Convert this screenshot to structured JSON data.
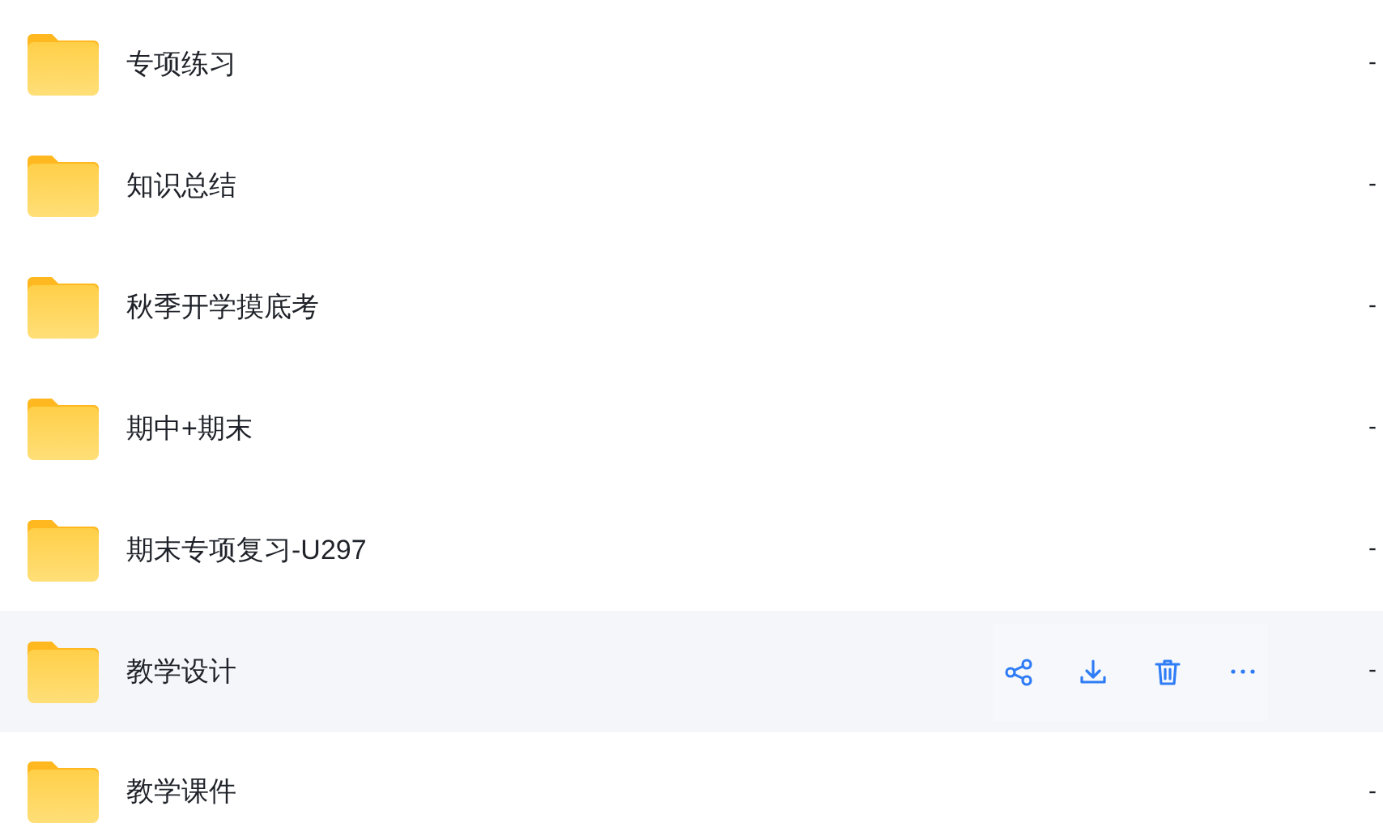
{
  "rows": [
    {
      "name": "专项练习",
      "size": "-",
      "hovered": false
    },
    {
      "name": "知识总结",
      "size": "-",
      "hovered": false
    },
    {
      "name": "秋季开学摸底考",
      "size": "-",
      "hovered": false
    },
    {
      "name": "期中+期末",
      "size": "-",
      "hovered": false
    },
    {
      "name": "期末专项复习-U297",
      "size": "-",
      "hovered": false
    },
    {
      "name": "教学设计",
      "size": "-",
      "hovered": true
    },
    {
      "name": "教学课件",
      "size": "-",
      "hovered": false
    }
  ]
}
